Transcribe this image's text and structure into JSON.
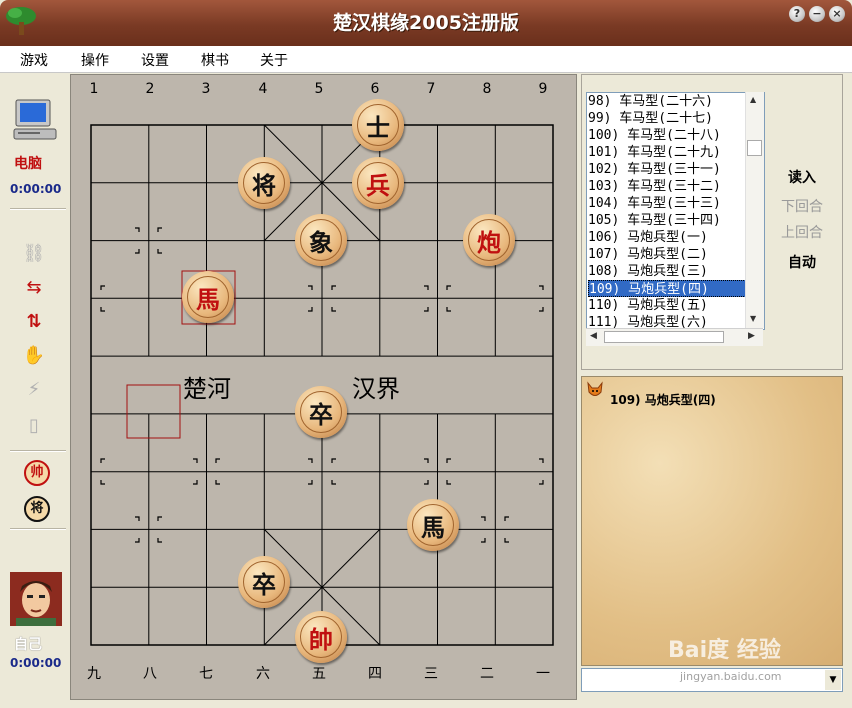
{
  "window": {
    "title": "楚汉棋缘2005注册版"
  },
  "menu": [
    "游戏",
    "操作",
    "设置",
    "棋书",
    "关于"
  ],
  "players": {
    "top": {
      "name": "电脑",
      "time": "0:00:00"
    },
    "bottom": {
      "name": "自己",
      "time": "0:00:00"
    }
  },
  "toolbar": {
    "red_side_glyph": "帅",
    "black_side_glyph": "将"
  },
  "board": {
    "top_numbers": [
      "1",
      "2",
      "3",
      "4",
      "5",
      "6",
      "7",
      "8",
      "9"
    ],
    "bottom_numbers": [
      "九",
      "八",
      "七",
      "六",
      "五",
      "四",
      "三",
      "二",
      "一"
    ],
    "river_left": "楚河",
    "river_right": "汉界",
    "pieces": [
      {
        "text": "士",
        "side": "black"
      },
      {
        "text": "将",
        "side": "black"
      },
      {
        "text": "兵",
        "side": "red"
      },
      {
        "text": "象",
        "side": "black"
      },
      {
        "text": "炮",
        "side": "red"
      },
      {
        "text": "馬",
        "side": "red"
      },
      {
        "text": "卒",
        "side": "black"
      },
      {
        "text": "馬",
        "side": "black"
      },
      {
        "text": "卒",
        "side": "black"
      },
      {
        "text": "帥",
        "side": "red"
      }
    ]
  },
  "game_list": {
    "items": [
      "98) 车马型(二十六)",
      "99) 车马型(二十七)",
      "100) 车马型(二十八)",
      "101) 车马型(二十九)",
      "102) 车马型(三十一)",
      "103) 车马型(三十二)",
      "104) 车马型(三十三)",
      "105) 车马型(三十四)",
      "106) 马炮兵型(一)",
      "107) 马炮兵型(二)",
      "108) 马炮兵型(三)",
      "109) 马炮兵型(四)",
      "110) 马炮兵型(五)",
      "111) 马炮兵型(六)"
    ],
    "selected_index": 11
  },
  "side_buttons": {
    "load": "读入",
    "next": "下回合",
    "prev": "上回合",
    "auto": "自动"
  },
  "notes": {
    "header": "109) 马炮兵型(四)"
  },
  "watermark": {
    "brand": "Bai度 经验",
    "url": "jingyan.baidu.com"
  }
}
